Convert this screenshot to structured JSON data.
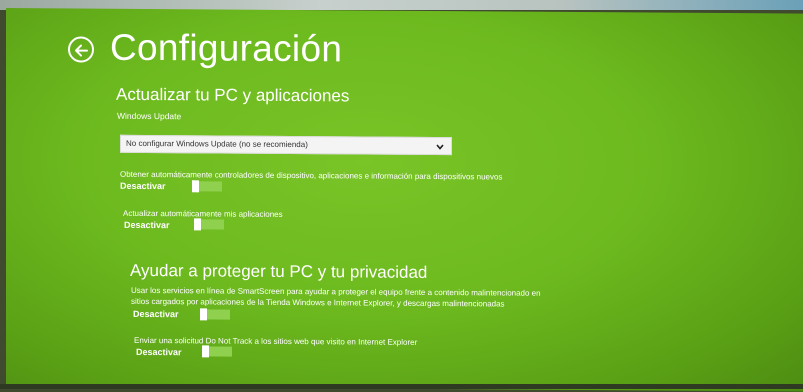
{
  "page": {
    "title": "Configuración"
  },
  "update_section": {
    "heading": "Actualizar tu PC y aplicaciones",
    "windows_update_label": "Windows Update",
    "windows_update_value": "No configurar Windows Update (no se recomienda)",
    "drivers_text": "Obtener automáticamente controladores de dispositivo, aplicaciones e información para dispositivos nuevos",
    "drivers_toggle_label": "Desactivar",
    "drivers_toggle_on": false,
    "apps_text": "Actualizar automáticamente mis aplicaciones",
    "apps_toggle_label": "Desactivar",
    "apps_toggle_on": false
  },
  "privacy_section": {
    "heading": "Ayudar a proteger tu PC y tu privacidad",
    "smartscreen_text_line1": "Usar los servicios en línea de SmartScreen para ayudar a proteger el equipo frente a contenido malintencionado en",
    "smartscreen_text_line2": "sitios cargados por aplicaciones de la Tienda Windows e Internet Explorer, y descargas malintencionadas",
    "smartscreen_toggle_label": "Desactivar",
    "smartscreen_toggle_on": false,
    "dnt_text": "Enviar una solicitud Do Not Track a los sitios web que visito en Internet Explorer",
    "dnt_toggle_label": "Desactivar",
    "dnt_toggle_on": false
  },
  "colors": {
    "background": "#6dba1f",
    "toggle_track": "#8fd04f",
    "text": "#ffffff"
  },
  "icons": {
    "back": "back-arrow-circle-icon",
    "dropdown": "chevron-down-icon"
  }
}
